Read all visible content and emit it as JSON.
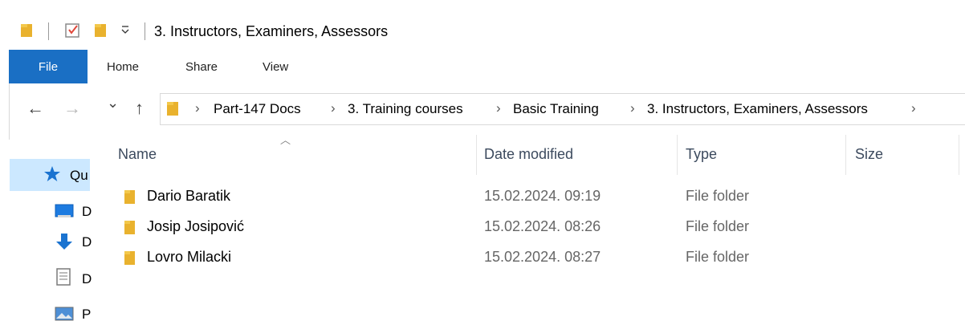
{
  "window": {
    "title": "3. Instructors, Examiners, Assessors",
    "quick_access_toolbar": [
      "folder-icon",
      "properties-checkbox-icon",
      "new-folder-icon",
      "customize-dropdown-icon"
    ]
  },
  "ribbon": {
    "tabs": [
      "File",
      "Home",
      "Share",
      "View"
    ],
    "accent_color": "#1a6fc4"
  },
  "navigation": {
    "back": "←",
    "forward": "→",
    "recent": "⌄",
    "up": "↑"
  },
  "address_bar": {
    "breadcrumbs": [
      "Part-147 Docs",
      "3. Training courses",
      "Basic Training",
      "3. Instructors, Examiners, Assessors"
    ],
    "separator": "›"
  },
  "nav_pane": {
    "items": [
      {
        "label": "Qu",
        "icon": "star-icon",
        "selected": true
      },
      {
        "label": "D",
        "icon": "desktop-icon"
      },
      {
        "label": "D",
        "icon": "download-icon"
      },
      {
        "label": "D",
        "icon": "document-icon"
      },
      {
        "label": "P",
        "icon": "picture-icon"
      }
    ]
  },
  "columns": {
    "name": "Name",
    "date_modified": "Date modified",
    "type": "Type",
    "size": "Size"
  },
  "files": [
    {
      "name": "Dario Baratik",
      "date_modified": "15.02.2024. 09:19",
      "type": "File folder"
    },
    {
      "name": "Josip Josipović",
      "date_modified": "15.02.2024. 08:26",
      "type": "File folder"
    },
    {
      "name": "Lovro Milacki",
      "date_modified": "15.02.2024. 08:27",
      "type": "File folder"
    }
  ]
}
